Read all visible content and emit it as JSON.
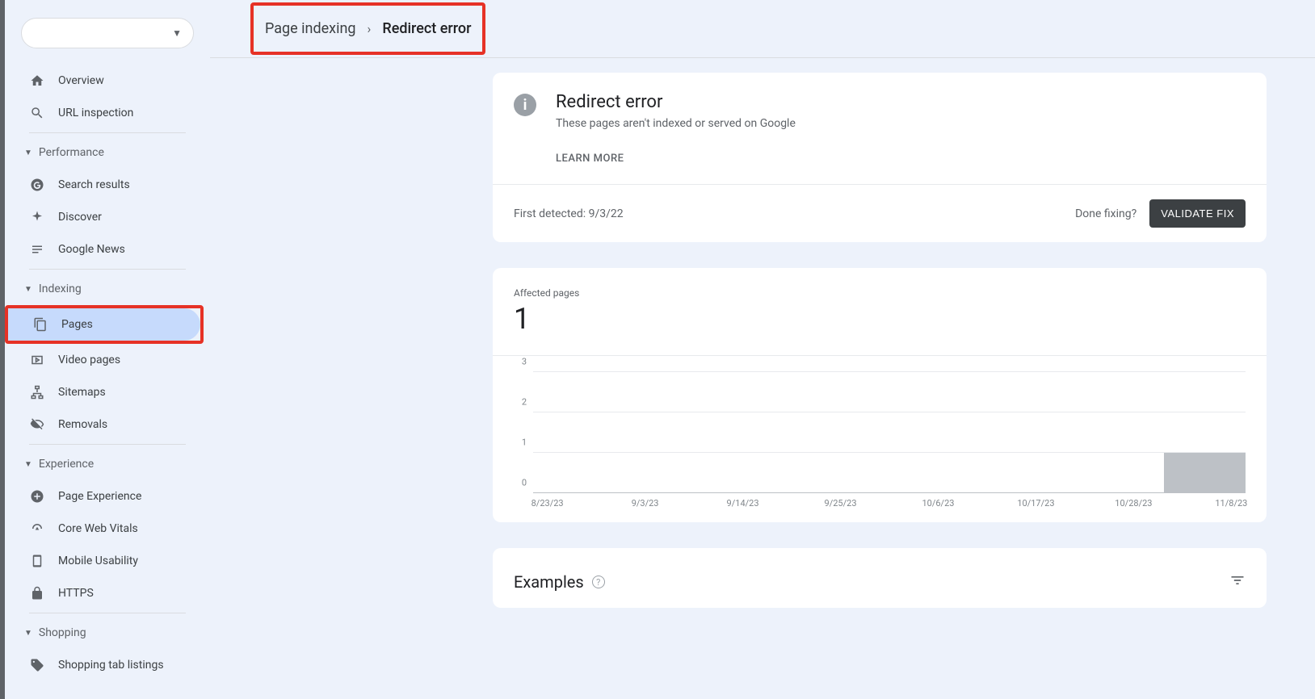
{
  "sidebar": {
    "items": {
      "overview": "Overview",
      "url_inspection": "URL inspection",
      "search_results": "Search results",
      "discover": "Discover",
      "google_news": "Google News",
      "pages": "Pages",
      "video_pages": "Video pages",
      "sitemaps": "Sitemaps",
      "removals": "Removals",
      "page_experience": "Page Experience",
      "core_web_vitals": "Core Web Vitals",
      "mobile_usability": "Mobile Usability",
      "https": "HTTPS",
      "shopping_tab": "Shopping tab listings"
    },
    "sections": {
      "performance": "Performance",
      "indexing": "Indexing",
      "experience": "Experience",
      "shopping": "Shopping"
    }
  },
  "breadcrumb": {
    "parent": "Page indexing",
    "current": "Redirect error"
  },
  "info": {
    "title": "Redirect error",
    "subtitle": "These pages aren't indexed or served on Google",
    "learn_more": "LEARN MORE"
  },
  "detection": {
    "first_detected": "First detected: 9/3/22",
    "done_fixing": "Done fixing?",
    "validate": "VALIDATE FIX"
  },
  "affected": {
    "label": "Affected pages",
    "count": "1"
  },
  "examples": {
    "title": "Examples"
  },
  "chart_data": {
    "type": "bar",
    "ylim": [
      0,
      3
    ],
    "y_ticks": [
      0,
      1,
      2,
      3
    ],
    "x_ticks": [
      "8/23/23",
      "9/3/23",
      "9/14/23",
      "9/25/23",
      "10/6/23",
      "10/17/23",
      "10/28/23",
      "11/8/23"
    ],
    "bar_region": {
      "start_frac": 0.885,
      "end_frac": 1.0,
      "value": 1
    }
  }
}
